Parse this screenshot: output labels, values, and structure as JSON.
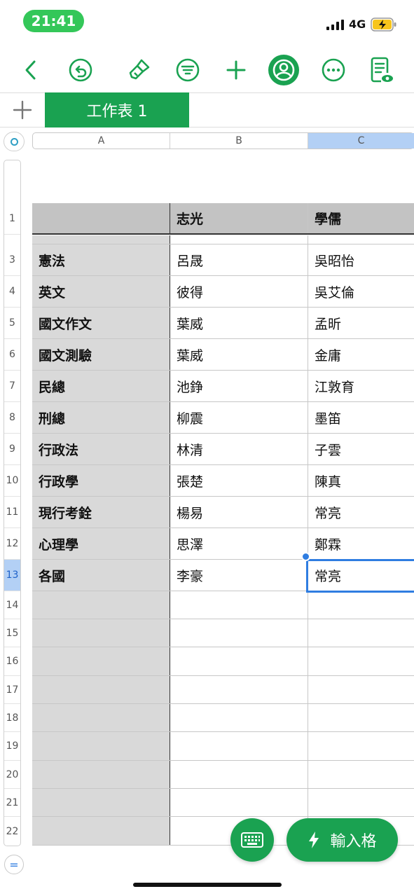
{
  "status_bar": {
    "time": "21:41",
    "network": "4G"
  },
  "tabs": [
    {
      "label": "工作表 1"
    }
  ],
  "columns": [
    "A",
    "B",
    "C"
  ],
  "header_row": {
    "row_num": "1",
    "a": "",
    "b": "志光",
    "c": "學儒"
  },
  "rows": [
    {
      "row_num": "3",
      "a": "憲法",
      "b": "呂晟",
      "c": "吳昭怡"
    },
    {
      "row_num": "4",
      "a": "英文",
      "b": "彼得",
      "c": "吳艾倫"
    },
    {
      "row_num": "5",
      "a": "國文作文",
      "b": "葉威",
      "c": "孟昕"
    },
    {
      "row_num": "6",
      "a": "國文測驗",
      "b": "葉威",
      "c": "金庸"
    },
    {
      "row_num": "7",
      "a": "民總",
      "b": "池錚",
      "c": "江敦育"
    },
    {
      "row_num": "8",
      "a": "刑總",
      "b": "柳震",
      "c": "墨笛"
    },
    {
      "row_num": "9",
      "a": "行政法",
      "b": "林清",
      "c": "子雲"
    },
    {
      "row_num": "10",
      "a": "行政學",
      "b": "張楚",
      "c": "陳真"
    },
    {
      "row_num": "11",
      "a": "現行考銓",
      "b": "楊易",
      "c": "常亮"
    },
    {
      "row_num": "12",
      "a": "心理學",
      "b": "思澤",
      "c": "鄭霖"
    },
    {
      "row_num": "13",
      "a": "各國",
      "b": "李豪",
      "c": "常亮"
    }
  ],
  "empty_rows": [
    "14",
    "15",
    "16",
    "17",
    "18",
    "19",
    "20",
    "21",
    "22"
  ],
  "bottom": {
    "input_label": "輸入格",
    "eq_symbol": "="
  },
  "colors": {
    "accent": "#1aa251",
    "selection": "#2f7de1",
    "header_gray": "#c3c3c3",
    "colA_gray": "#d9d9d9"
  },
  "icons": [
    "back-icon",
    "undo-icon",
    "paintbrush-icon",
    "filter-icon",
    "add-icon",
    "collaborate-icon",
    "more-icon",
    "view-document-icon",
    "keyboard-icon",
    "bolt-icon"
  ]
}
